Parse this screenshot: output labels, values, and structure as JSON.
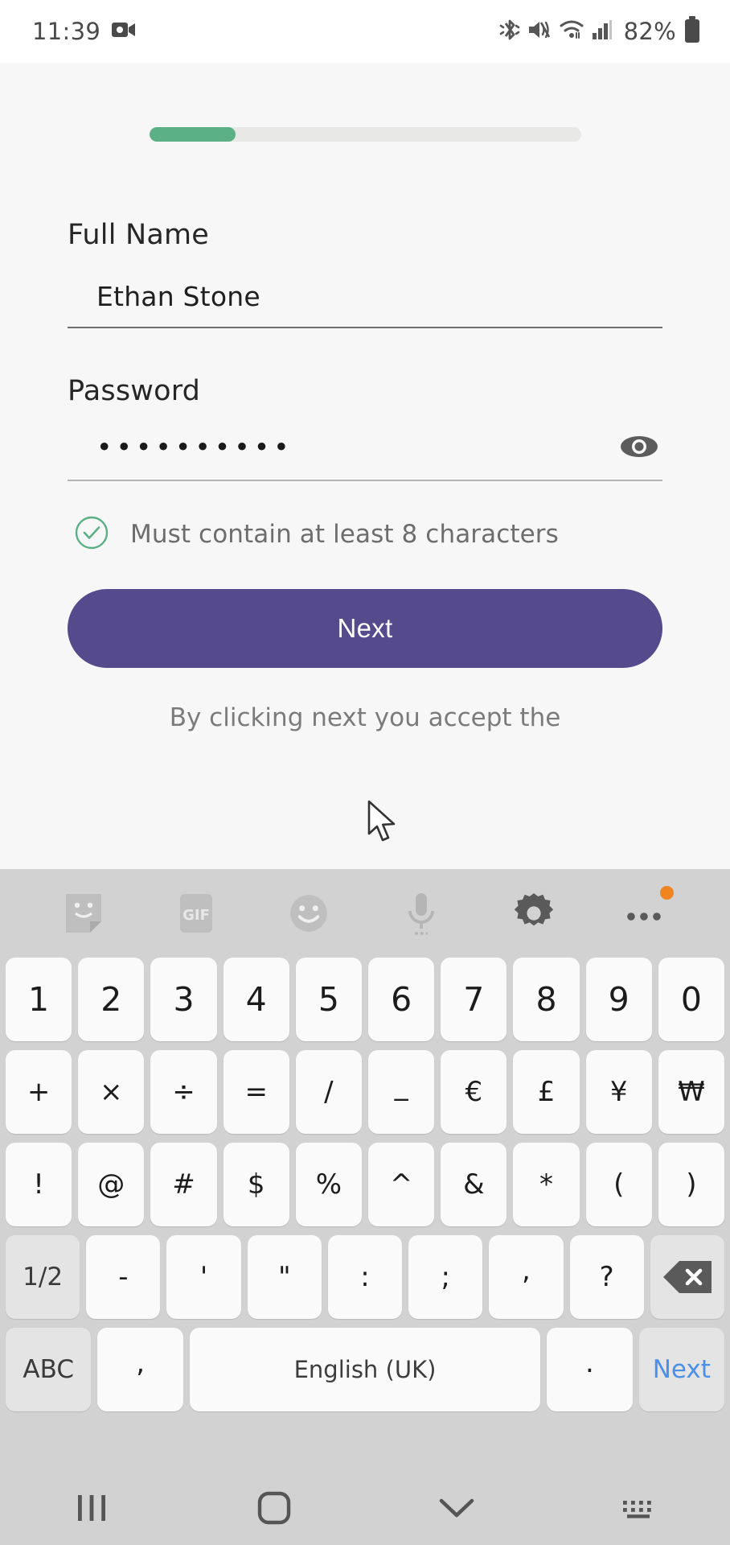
{
  "statusbar": {
    "time": "11:39",
    "battery_percent": "82%",
    "icons": [
      "video-recording-icon",
      "bluetooth-icon",
      "vibrate-mute-icon",
      "wifi-icon",
      "cellular-signal-icon",
      "battery-icon"
    ]
  },
  "signup": {
    "progress": {
      "percent": 20,
      "fill_color": "#5cb085",
      "track_color": "#e8e8e6"
    },
    "name_field": {
      "label": "Full Name",
      "value": "Ethan Stone",
      "placeholder": "Full Name"
    },
    "password_field": {
      "label": "Password",
      "value": "••••••••••",
      "placeholder": "Password",
      "char_count": 10
    },
    "hint": {
      "text": "Must contain at least 8 characters",
      "state": "valid",
      "color": "#5cb085"
    },
    "next_button": {
      "label": "Next",
      "color": "#544a8c"
    },
    "terms": {
      "line1": "By clicking next you accept the",
      "line2": ""
    }
  },
  "keyboard": {
    "toolbar": [
      "sticker-icon",
      "gif-icon",
      "emoji-icon",
      "microphone-icon",
      "settings-gear-icon",
      "more-options-icon"
    ],
    "badge_color": "#f08421",
    "rows": [
      {
        "keys": [
          {
            "label": "1",
            "type": "digit"
          },
          {
            "label": "2",
            "type": "digit"
          },
          {
            "label": "3",
            "type": "digit"
          },
          {
            "label": "4",
            "type": "digit"
          },
          {
            "label": "5",
            "type": "digit"
          },
          {
            "label": "6",
            "type": "digit"
          },
          {
            "label": "7",
            "type": "digit"
          },
          {
            "label": "8",
            "type": "digit"
          },
          {
            "label": "9",
            "type": "digit"
          },
          {
            "label": "0",
            "type": "digit"
          }
        ]
      },
      {
        "keys": [
          {
            "label": "+",
            "type": "sym"
          },
          {
            "label": "×",
            "type": "sym"
          },
          {
            "label": "÷",
            "type": "sym"
          },
          {
            "label": "=",
            "type": "sym"
          },
          {
            "label": "/",
            "type": "sym"
          },
          {
            "label": "_",
            "type": "lowsym"
          },
          {
            "label": "€",
            "type": "sym"
          },
          {
            "label": "£",
            "type": "sym"
          },
          {
            "label": "¥",
            "type": "sym"
          },
          {
            "label": "₩",
            "type": "sym"
          }
        ]
      },
      {
        "keys": [
          {
            "label": "!",
            "type": "sym"
          },
          {
            "label": "@",
            "type": "sym"
          },
          {
            "label": "#",
            "type": "sym"
          },
          {
            "label": "$",
            "type": "sym"
          },
          {
            "label": "%",
            "type": "sym"
          },
          {
            "label": "^",
            "type": "sym"
          },
          {
            "label": "&",
            "type": "sym"
          },
          {
            "label": "*",
            "type": "sym"
          },
          {
            "label": "(",
            "type": "sym"
          },
          {
            "label": ")",
            "type": "sym"
          }
        ]
      },
      {
        "keys": [
          {
            "label": "1/2",
            "type": "fn"
          },
          {
            "label": "-",
            "type": "sym"
          },
          {
            "label": "'",
            "type": "sym"
          },
          {
            "label": "\"",
            "type": "sym"
          },
          {
            "label": ":",
            "type": "sym"
          },
          {
            "label": ";",
            "type": "sym"
          },
          {
            "label": ",",
            "type": "lowsym"
          },
          {
            "label": "?",
            "type": "sym"
          },
          {
            "label": "",
            "type": "backspace"
          }
        ]
      },
      {
        "keys": [
          {
            "label": "ABC",
            "type": "fn"
          },
          {
            "label": ",",
            "type": "lowsym"
          },
          {
            "label": "English (UK)",
            "type": "space"
          },
          {
            "label": ".",
            "type": "lowsym"
          },
          {
            "label": "Next",
            "type": "next"
          }
        ]
      }
    ]
  },
  "navbar": {
    "items": [
      "recents-button",
      "home-button",
      "hide-keyboard-chevron-icon",
      "keyboard-switch-icon"
    ]
  }
}
